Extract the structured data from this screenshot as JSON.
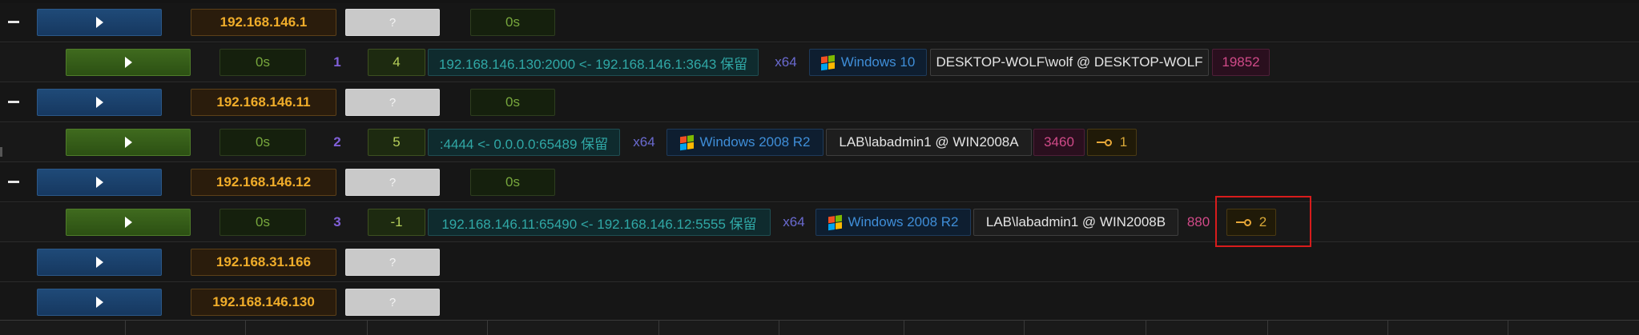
{
  "hosts": [
    {
      "ip": "192.168.146.1",
      "status": "?",
      "time": "0s"
    },
    {
      "ip": "192.168.146.11",
      "status": "?",
      "time": "0s"
    },
    {
      "ip": "192.168.146.12",
      "status": "?",
      "time": "0s"
    },
    {
      "ip": "192.168.31.166",
      "status": "?"
    },
    {
      "ip": "192.168.146.130",
      "status": "?"
    }
  ],
  "sessions": [
    {
      "time": "0s",
      "id": "1",
      "processes": "4",
      "connection": "192.168.146.130:2000 <- 192.168.146.1:3643 保留",
      "arch": "x64",
      "os": "Windows 10",
      "user": "DESKTOP-WOLF\\wolf @ DESKTOP-WOLF",
      "pid": "19852"
    },
    {
      "time": "0s",
      "id": "2",
      "processes": "5",
      "connection": ":4444 <- 0.0.0.0:65489 保留",
      "arch": "x64",
      "os": "Windows 2008 R2",
      "user": "LAB\\labadmin1 @ WIN2008A",
      "pid": "3460",
      "tunnels": "1"
    },
    {
      "time": "0s",
      "id": "3",
      "processes": "-1",
      "connection": "192.168.146.11:65490 <- 192.168.146.12:5555 保留",
      "arch": "x64",
      "os": "Windows 2008 R2",
      "user": "LAB\\labadmin1 @ WIN2008B",
      "pid": "880",
      "tunnels": "2"
    }
  ],
  "icons": {
    "expand": "collapse-minus-icon",
    "play": "play-icon",
    "os": "windows-logo-icon",
    "tunnel": "key-icon"
  },
  "colors": {
    "host_button": "#1f4a78",
    "session_button": "#3f6a1e",
    "ip_text": "#f0ad2a",
    "connection_text": "#30a8a6",
    "os_text": "#3f8ed8",
    "pid_text": "#d04a88",
    "highlight_box": "#d81c1c"
  }
}
